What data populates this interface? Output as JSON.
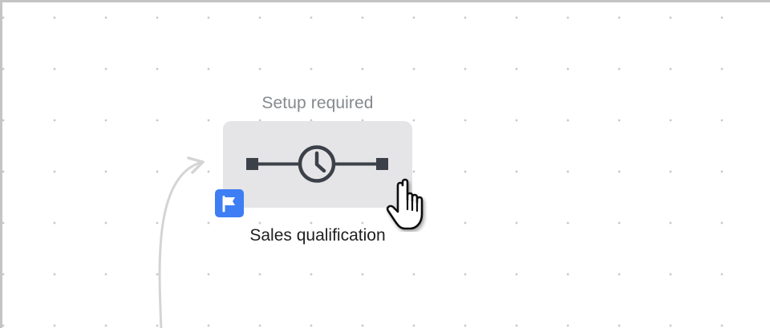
{
  "canvas": {
    "background": "#ffffff",
    "dot_color": "#c9c9c9"
  },
  "step": {
    "status_label": "Setup required",
    "title": "Sales qualification",
    "icon": "clock-timer-icon",
    "badge_icon": "flag-icon",
    "badge_color": "#3d7ef4",
    "node_color": "#e5e5e7"
  },
  "cursor": {
    "icon": "hand-pointer-icon"
  }
}
